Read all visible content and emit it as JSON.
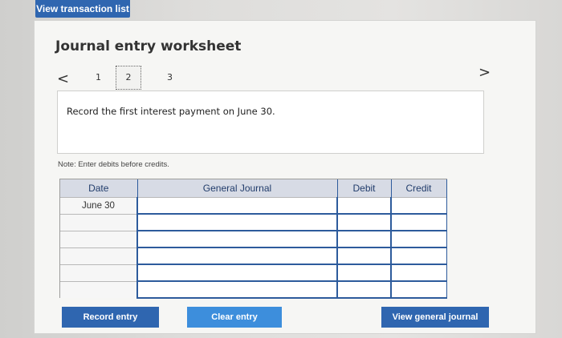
{
  "top_button": {
    "label": "View transaction list"
  },
  "worksheet": {
    "title": "Journal entry worksheet",
    "nav": {
      "prev": "<",
      "next": ">",
      "steps": [
        "1",
        "2",
        "3"
      ]
    },
    "instruction": "Record the first interest payment on June 30.",
    "note": "Note: Enter debits before credits."
  },
  "table": {
    "headers": [
      "Date",
      "General Journal",
      "Debit",
      "Credit"
    ],
    "rows": [
      [
        "June 30",
        "",
        "",
        ""
      ],
      [
        "",
        "",
        "",
        ""
      ],
      [
        "",
        "",
        "",
        ""
      ],
      [
        "",
        "",
        "",
        ""
      ],
      [
        "",
        "",
        "",
        ""
      ],
      [
        "",
        "",
        "",
        ""
      ]
    ]
  },
  "actions": {
    "record": "Record entry",
    "clear": "Clear entry",
    "view_general_journal": "View general journal"
  }
}
